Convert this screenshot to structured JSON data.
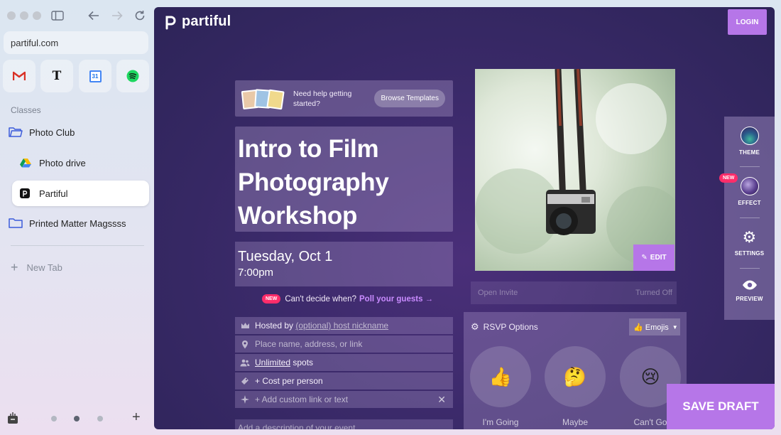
{
  "browser": {
    "url": "partiful.com",
    "favorites": [
      "gmail-icon",
      "nytimes-icon",
      "calendar-icon",
      "spotify-icon"
    ],
    "section_label": "Classes",
    "items": [
      {
        "label": "Photo Club",
        "icon": "folder-icon"
      },
      {
        "label": "Photo drive",
        "icon": "google-drive-icon"
      },
      {
        "label": "Partiful",
        "icon": "partiful-icon"
      },
      {
        "label": "Printed Matter Magssss",
        "icon": "folder-icon"
      }
    ],
    "new_tab": "New Tab",
    "calendar_day": "31"
  },
  "page": {
    "brand": "partiful",
    "login": "LOGIN",
    "help": {
      "text": "Need help getting started?",
      "button": "Browse Templates"
    },
    "event_title": "Intro to Film Photography Workshop",
    "date": "Tuesday, Oct 1",
    "time": "7:00pm",
    "poll": {
      "badge": "NEW",
      "text": "Can't decide when?",
      "link": "Poll your guests →"
    },
    "fields": {
      "host_prefix": "Hosted by",
      "host_link": "(optional) host nickname",
      "location": "Place name, address, or link",
      "spots_link": "Unlimited",
      "spots_suffix": "spots",
      "cost": "+ Cost per person",
      "custom_link": "+ Add custom link or text",
      "description": "Add a description of your event"
    },
    "edit": "EDIT",
    "open_invite": {
      "label": "Open Invite",
      "status": "Turned Off"
    },
    "rsvp": {
      "title": "RSVP Options",
      "select": "👍 Emojis",
      "options": [
        {
          "emoji": "👍",
          "label": "I'm Going"
        },
        {
          "emoji": "🤔",
          "label": "Maybe"
        },
        {
          "emoji": "😢",
          "label": "Can't Go"
        }
      ]
    },
    "panel": {
      "theme": "THEME",
      "effect": "EFFECT",
      "effect_badge": "NEW",
      "settings": "SETTINGS",
      "preview": "PREVIEW"
    },
    "save_draft": "SAVE DRAFT"
  },
  "colors": {
    "accent": "#b676e8",
    "background": "#3b2a6a",
    "badge": "#ff2d6a"
  }
}
